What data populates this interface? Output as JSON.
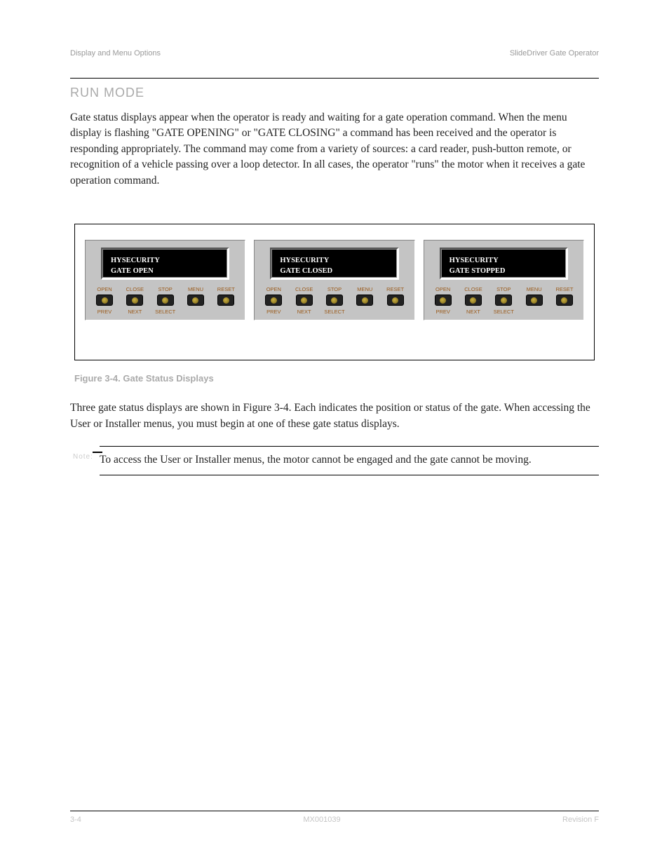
{
  "header": {
    "left": "Display and Menu Options",
    "right": "SlideDriver Gate Operator"
  },
  "section_title": "RUN MODE",
  "paragraph1": "Gate status displays appear when the operator is ready and waiting for a gate operation command. When the menu display is flashing \"GATE OPENING\" or \"GATE CLOSING\" a command has been received and the operator is responding appropriately. The command may come from a variety of sources: a card reader, push-button remote, or recognition of a vehicle passing over a loop detector. In all cases, the operator \"runs\" the motor when it receives a gate operation command.",
  "panels": [
    {
      "line1": "HYSECURITY",
      "line2": "GATE OPEN"
    },
    {
      "line1": "HYSECURITY",
      "line2": "GATE CLOSED"
    },
    {
      "line1": "HYSECURITY",
      "line2": "GATE STOPPED"
    }
  ],
  "buttons": {
    "top": [
      "OPEN",
      "CLOSE",
      "STOP",
      "MENU",
      "RESET"
    ],
    "bottom": [
      "PREV",
      "NEXT",
      "SELECT",
      "",
      ""
    ]
  },
  "figure_caption": "Figure 3-4. Gate Status Displays",
  "paragraph2": "Three gate status displays are shown in Figure 3-4. Each indicates the position or status of the gate. When accessing the User or Installer menus, you must begin at one of these gate status displays.",
  "note_label": "Note:",
  "note_text": "To access the User or Installer menus, the motor cannot be engaged and the gate cannot be moving.",
  "footer": {
    "left": "3-4",
    "center": "MX001039",
    "right": "Revision F"
  }
}
